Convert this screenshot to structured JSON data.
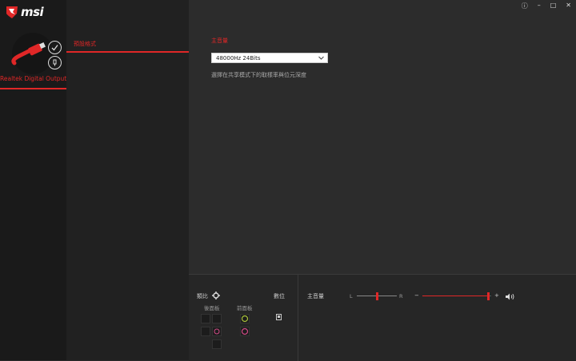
{
  "app": {
    "logo_text": "msi",
    "title_controls": {
      "info": "ⓘ",
      "minimize": "–",
      "maximize": "□",
      "close": "✕"
    }
  },
  "device": {
    "label": "Realtek Digital Output"
  },
  "menu": {
    "items": [
      {
        "label": "預設格式"
      }
    ]
  },
  "main": {
    "section_label": "主音量",
    "format_select": {
      "value": "48000Hz 24Bits"
    },
    "description": "選擇在共享模式下的取樣率與位元深度"
  },
  "bottom": {
    "analog_label": "類比",
    "digital_label": "數位",
    "rear_panel_label": "後面板",
    "front_panel_label": "前面板",
    "master_volume_label": "主音量",
    "balance": {
      "left_label": "L",
      "right_label": "R",
      "value": 0.5
    },
    "volume": {
      "minus_label": "−",
      "plus_label": "+",
      "value": 0.97
    }
  },
  "colors": {
    "accent": "#e02727",
    "jack_green": "#a9c23a",
    "jack_pink": "#d04a86"
  }
}
